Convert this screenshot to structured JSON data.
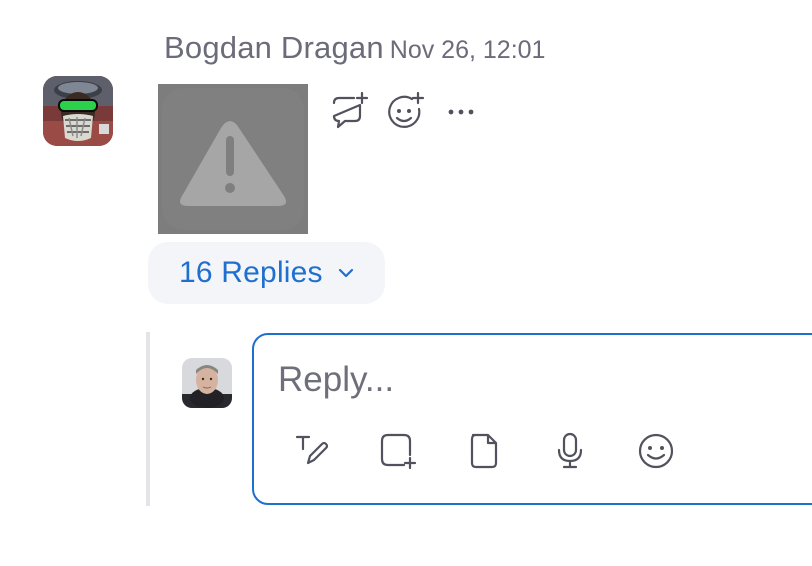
{
  "message": {
    "sender_name": "Bogdan Dragan",
    "timestamp": "Nov 26, 12:01",
    "attachment_icon": "warning-icon",
    "actions": [
      {
        "name": "reply-in-thread",
        "icon": "comment-add-icon"
      },
      {
        "name": "add-reaction",
        "icon": "emoji-add-icon"
      },
      {
        "name": "more-options",
        "icon": "more-horizontal-icon"
      }
    ]
  },
  "thread": {
    "replies_label": "16 Replies",
    "chevron_icon": "chevron-down-icon"
  },
  "composer": {
    "placeholder": "Reply...",
    "tools": [
      {
        "name": "text-format",
        "icon": "text-format-icon"
      },
      {
        "name": "screenshot",
        "icon": "screenshot-icon"
      },
      {
        "name": "attach-file",
        "icon": "file-icon"
      },
      {
        "name": "voice-message",
        "icon": "microphone-icon"
      },
      {
        "name": "emoji",
        "icon": "emoji-icon"
      }
    ]
  },
  "colors": {
    "accent": "#1f6fcf",
    "text_secondary": "#6b6b7a",
    "icon": "#52525e",
    "pill_background": "#f3f5f9",
    "thread_bar": "#e4e4e8"
  }
}
